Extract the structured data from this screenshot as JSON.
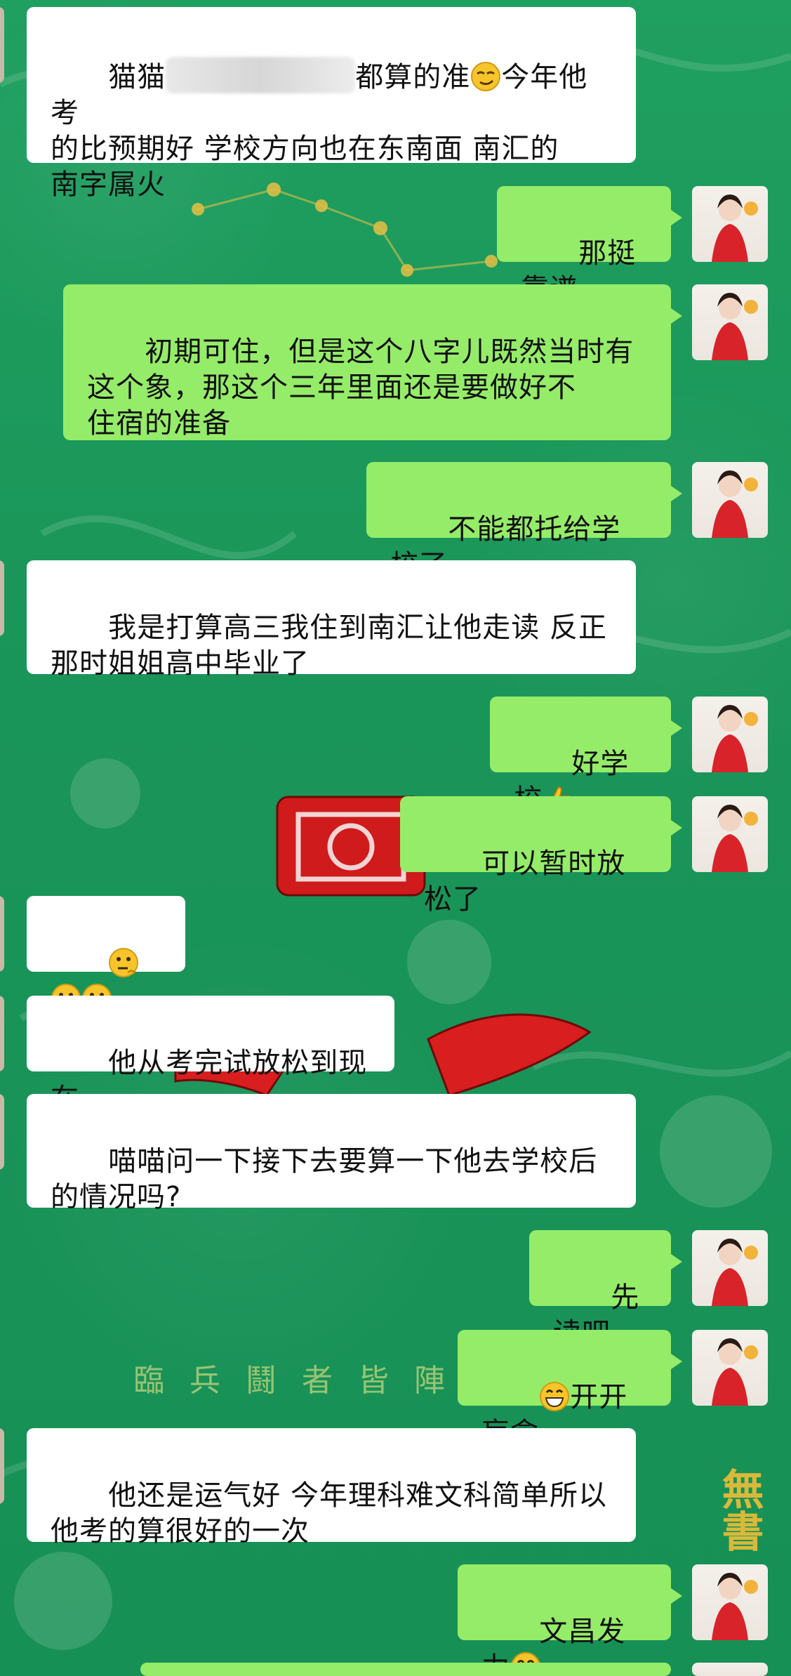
{
  "colors": {
    "background": "#1b9a5c",
    "bubble_in": "#ffffff",
    "bubble_out": "#95ec69",
    "text": "#111111"
  },
  "background_art": {
    "motto": "臨兵鬪者皆陣列",
    "corner_text": "無書"
  },
  "messages": [
    {
      "side": "in",
      "text_before": "猫猫",
      "redacted": true,
      "text_after": "都算的准",
      "emoji_mid": "smirk-emoji",
      "text_rest": "今年他考\n的比预期好 学校方向也在东南面 南汇的\n南字属火"
    },
    {
      "side": "out",
      "text": "那挺靠谱"
    },
    {
      "side": "out",
      "text": "初期可住，但是这个八字儿既然当时有\n这个象，那这个三年里面还是要做好不\n住宿的准备"
    },
    {
      "side": "out",
      "text": "不能都托给学校了"
    },
    {
      "side": "in",
      "text": "我是打算高三我住到南汇让他走读 反正\n那时姐姐高中毕业了"
    },
    {
      "side": "out",
      "text": "好学校",
      "emoji_after": "thumbs-up-emoji"
    },
    {
      "side": "out",
      "text": "可以暂时放松了"
    },
    {
      "side": "in",
      "emojis": [
        "thinking-emoji",
        "thinking-emoji",
        "thinking-emoji"
      ]
    },
    {
      "side": "in",
      "text": "他从考完试放松到现在"
    },
    {
      "side": "in",
      "text": "喵喵问一下接下去要算一下他去学校后\n的情况吗?"
    },
    {
      "side": "out",
      "text": "先读吧"
    },
    {
      "side": "out",
      "text": "开开盲盒",
      "emoji_before": "grin-emoji"
    },
    {
      "side": "in",
      "text": "他还是运气好 今年理科难文科简单所以\n他考的算很好的一次"
    },
    {
      "side": "out",
      "text": "文昌发力",
      "emoji_after": "grin-emoji"
    }
  ]
}
